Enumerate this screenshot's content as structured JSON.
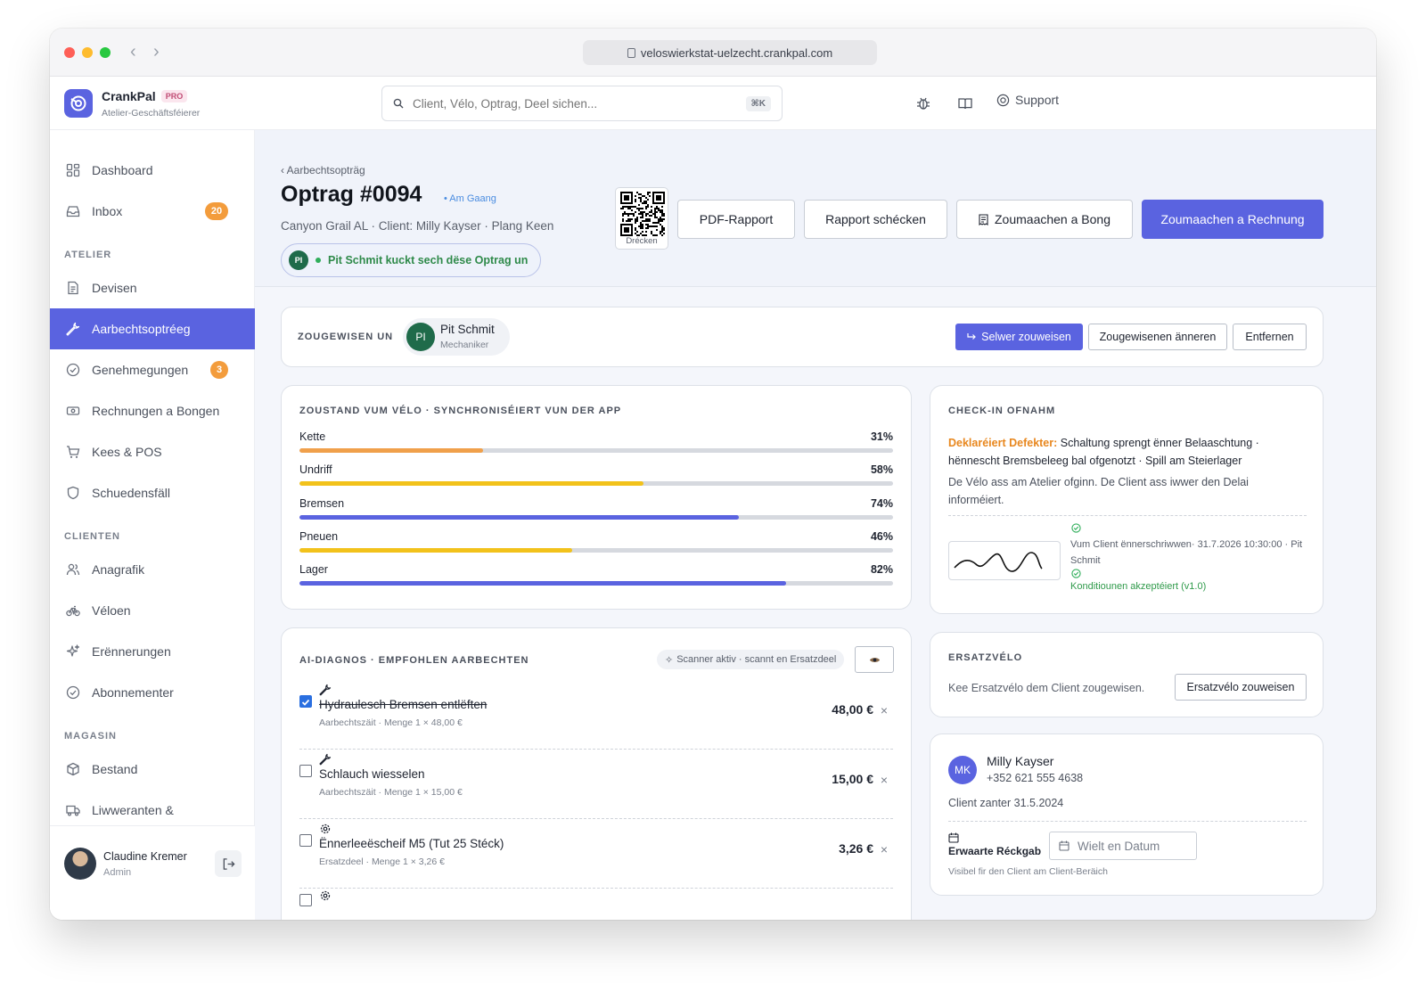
{
  "browser": {
    "url": "veloswierkstat-uelzecht.crankpal.com"
  },
  "app": {
    "name": "CrankPal",
    "plan": "PRO",
    "subtitle": "Atelier-Geschäftsféierer"
  },
  "search": {
    "placeholder": "Client, Vélo, Optrag, Deel sichen...",
    "shortcut": "⌘K"
  },
  "header": {
    "support": "Support"
  },
  "sidebar": {
    "dashboard": "Dashboard",
    "inbox": "Inbox",
    "inbox_count": "20",
    "sec_atelier": "ATELIER",
    "devisen": "Devisen",
    "auftraege": "Aarbechtsoptréeg",
    "genehmegungen": "Genehmegungen",
    "genehmegungen_count": "3",
    "rechnungen": "Rechnungen a Bongen",
    "kees": "Kees & POS",
    "schued": "Schuedensfäll",
    "sec_clienten": "CLIENTEN",
    "anagrafik": "Anagrafik",
    "veloen": "Véloen",
    "erennerungen": "Erënnerungen",
    "abonnementer": "Abonnementer",
    "sec_magasin": "MAGASIN",
    "bestand": "Bestand",
    "liwweranten": "Liwweranten &"
  },
  "user": {
    "name": "Claudine Kremer",
    "role": "Admin"
  },
  "job": {
    "breadcrumb": "‹ Aarbechtsopträg",
    "title": "Optrag #0094",
    "status": "• Am Gaang",
    "subtitle": "Canyon Grail AL · Client: Milly Kayser · Plang Keen",
    "watcher_initials": "PI",
    "watcher_text": "Pit Schmit kuckt sech dëse Optrag un",
    "qr_label": "Drécken",
    "btn_pdf": "PDF-Rapport",
    "btn_send": "Rapport schécken",
    "btn_bong": "Zoumaachen a Bong",
    "btn_invoice": "Zoumaachen a Rechnung"
  },
  "assign": {
    "label": "ZOUGEWISEN UN",
    "initials": "PI",
    "name": "Pit Schmit",
    "role": "Mechaniker",
    "btn_self": "Selwer zouweisen",
    "btn_change": "Zougewisenen änneren",
    "btn_remove": "Entfernen"
  },
  "condition": {
    "heading": "ZOUSTAND VUM VÉLO · SYNCHRONISÉIERT VUN DER APP",
    "items": [
      {
        "label": "Kette",
        "value": 31,
        "display": "31%",
        "color": "#f0a04b"
      },
      {
        "label": "Undriff",
        "value": 58,
        "display": "58%",
        "color": "#f2c21b"
      },
      {
        "label": "Bremsen",
        "value": 74,
        "display": "74%",
        "color": "#5a63e0"
      },
      {
        "label": "Pneuen",
        "value": 46,
        "display": "46%",
        "color": "#f2c21b"
      },
      {
        "label": "Lager",
        "value": 82,
        "display": "82%",
        "color": "#5a63e0"
      }
    ]
  },
  "checkin": {
    "heading": "CHECK-IN OFNAHM",
    "defect_label": "Deklaréiert Defekter:",
    "defect_text": "Schaltung sprengt ënner Belaaschtung · hënnescht Bremsbeleeg bal ofgenotzt · Spill am Steierlager",
    "note": "De Vélo ass am Atelier ofginn. De Client ass iwwer den Delai informéiert.",
    "signed": "Vum Client ënnerschriwwen· 31.7.2026 10:30:00 · Pit Schmit",
    "accepted": "Konditiounen akzeptéiert (v1.0)"
  },
  "diagnosis": {
    "heading": "AI-DIAGNOS · EMPFOHLEN AARBECHTEN",
    "scanner": "Scanner aktiv · scannt en Ersatzdeel",
    "items": [
      {
        "name": "Hydraulesch Bremsen entlëften",
        "meta": "Aarbechtszäit · Menge 1 × 48,00 €",
        "price": "48,00 €",
        "checked": true,
        "icon": "wrench-icon"
      },
      {
        "name": "Schlauch wiesselen",
        "meta": "Aarbechtszäit · Menge 1 × 15,00 €",
        "price": "15,00 €",
        "checked": false,
        "icon": "wrench-icon"
      },
      {
        "name": "Ënnerleeëscheif M5 (Tut 25 Stéck)",
        "meta": "Ersatzdeel · Menge 1 × 3,26 €",
        "price": "3,26 €",
        "checked": false,
        "icon": "gear-icon"
      }
    ]
  },
  "replacement": {
    "heading": "ERSATZVÉLO",
    "text": "Kee Ersatzvélo dem Client zougewisen.",
    "btn": "Ersatzvélo zouweisen"
  },
  "client": {
    "initials": "MK",
    "name": "Milly Kayser",
    "phone": "+352 621 555 4638",
    "since": "Client zanter 31.5.2024",
    "return_label": "Erwaarte Réckgab",
    "date_placeholder": "Wielt en Datum",
    "visible_note": "Visibel fir den Client am Client-Beräich"
  }
}
